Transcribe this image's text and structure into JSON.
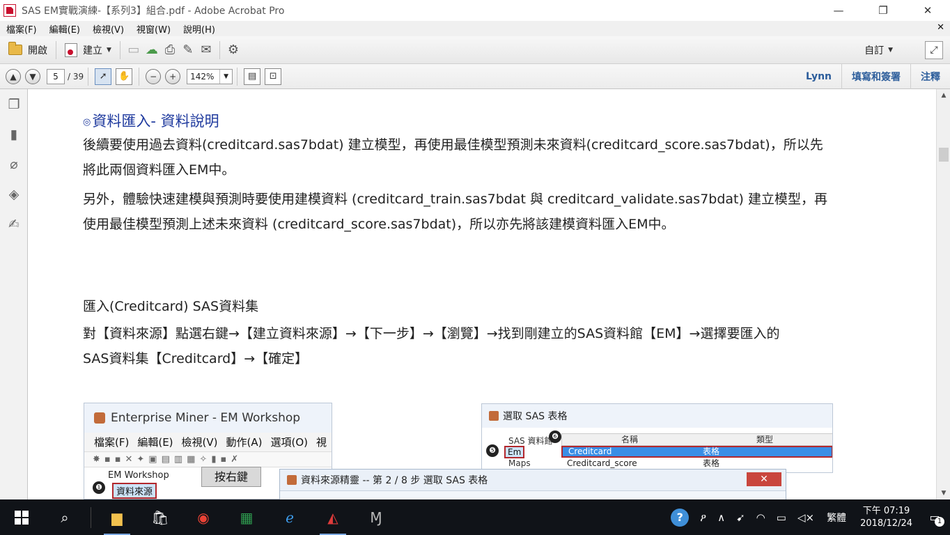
{
  "window": {
    "title": "SAS EM實戰演練-【系列3】組合.pdf - Adobe Acrobat Pro",
    "minimize": "—",
    "maximize": "❐",
    "close": "✕"
  },
  "menubar": {
    "items": [
      "檔案(F)",
      "編輯(E)",
      "檢視(V)",
      "視窗(W)",
      "說明(H)"
    ],
    "doc_close": "✕"
  },
  "toolbar1": {
    "open_label": "開啟",
    "create_label": "建立",
    "customize_label": "自訂"
  },
  "toolbar2": {
    "page_current": "5",
    "page_total": "/ 39",
    "zoom": "142%",
    "user": "Lynn",
    "fill_sign": "填寫和簽署",
    "comment": "注釋"
  },
  "document": {
    "heading_bullet": "◎",
    "heading": "資料匯入- 資料說明",
    "para1_line1": "後續要使用過去資料(creditcard.sas7bdat) 建立模型，再使用最佳模型預測未來資料(creditcard_score.sas7bdat)，所以先",
    "para1_line2": "將此兩個資料匯入EM中。",
    "para2_line1": "另外，體驗快速建模與預測時要使用建模資料 (creditcard_train.sas7bdat 與 creditcard_validate.sas7bdat) 建立模型，再",
    "para2_line2": "使用最佳模型預測上述未來資料 (creditcard_score.sas7bdat)，所以亦先將該建模資料匯入EM中。",
    "subheading": "匯入(Creditcard) SAS資料集",
    "para3_line1": "對【資料來源】點選右鍵→【建立資料來源】→【下一步】→【瀏覽】→找到剛建立的SAS資料館【EM】→選擇要匯入的",
    "para3_line2": "SAS資料集【Creditcard】→【確定】"
  },
  "shot1": {
    "title": "Enterprise Miner - EM Workshop",
    "menu": [
      "檔案(F)",
      "編輯(E)",
      "檢視(V)",
      "動作(A)",
      "選項(O)",
      "視"
    ],
    "tree_root": "EM Workshop",
    "tree_child": "資料來源",
    "badge": "❶",
    "callout": "按右鍵"
  },
  "dialog": {
    "title": "資料來源精靈 -- 第 2 / 8 步 選取 SAS 表格",
    "close": "✕"
  },
  "shot2": {
    "title": "選取 SAS 表格",
    "lib_root": "SAS 資料館",
    "lib_em": "Em",
    "lib_maps": "Maps",
    "badge5": "❺",
    "badge6": "❻",
    "col_name": "名稱",
    "col_type": "類型",
    "rows": [
      {
        "name": "Creditcard",
        "type": "表格"
      },
      {
        "name": "Creditcard_score",
        "type": "表格"
      }
    ]
  },
  "taskbar": {
    "lang": "繁體",
    "time": "下午 07:19",
    "date": "2018/12/24",
    "notif_count": "1"
  }
}
